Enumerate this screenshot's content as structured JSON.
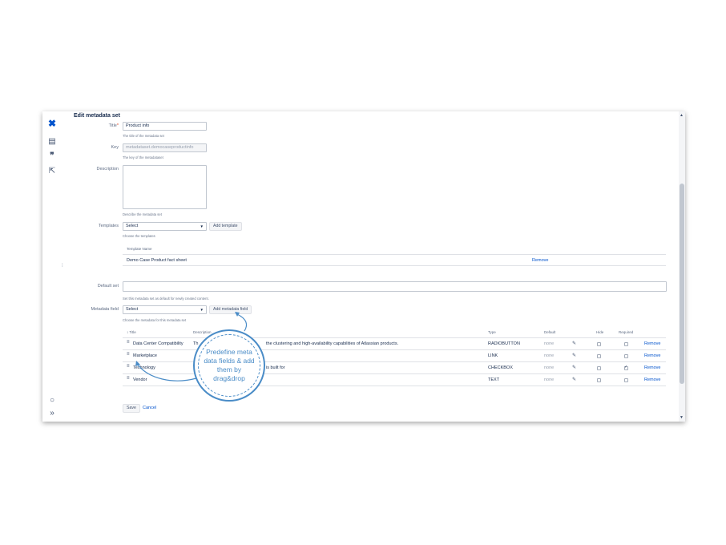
{
  "sidebar": {
    "icons": [
      "confluence-logo-icon",
      "page-icon",
      "quote-icon",
      "export-icon",
      "settings-icon",
      "expand-icon"
    ]
  },
  "form": {
    "heading": "Edit metadata set",
    "title": {
      "label": "Title",
      "required_mark": "*",
      "value": "Product info",
      "help": "The title of the metadata set"
    },
    "key": {
      "label": "Key",
      "value": "metadataset.democaseproductinfo",
      "help": "The key of the metadataset"
    },
    "description": {
      "label": "Description",
      "value": "",
      "help": "Describe the metadata set"
    },
    "templates": {
      "label": "Templates",
      "select_value": "Select",
      "add_button": "Add template",
      "help": "Choose the templates",
      "column_header": "Template Name",
      "rows": [
        {
          "name": "Demo Case Product fact sheet",
          "action": "Remove"
        }
      ]
    },
    "default_set": {
      "label": "Default set",
      "value": "",
      "help": "Set this metadata set as default for newly created content."
    },
    "metadata_field": {
      "label": "Metadata field",
      "select_value": "Select",
      "add_button": "Add metadata field",
      "help": "Choose the metadata for this metadata set",
      "columns": {
        "title": "Title",
        "sort_icon": "↕",
        "description": "Description",
        "type": "Type",
        "default": "Default",
        "hide": "Hide",
        "required": "Required"
      },
      "rows": [
        {
          "title": "Data Center Compatibility",
          "description_start": "Th",
          "description_end": "the clustering and high-availability capabilities of Atlassian products.",
          "type": "RADIOBUTTON",
          "default": "none",
          "hide": false,
          "required": false,
          "action": "Remove"
        },
        {
          "title": "Marketplace",
          "description_start": "",
          "description_end": "",
          "type": "LINK",
          "default": "none",
          "hide": false,
          "required": false,
          "action": "Remove"
        },
        {
          "title": "Technology",
          "description_start": "",
          "description_end": "is built for",
          "type": "CHECKBOX",
          "default": "none",
          "hide": false,
          "required": true,
          "action": "Remove"
        },
        {
          "title": "Vendor",
          "description_start": "",
          "description_end": "",
          "type": "TEXT",
          "default": "none",
          "hide": false,
          "required": false,
          "action": "Remove"
        }
      ]
    },
    "save_button": "Save",
    "cancel_link": "Cancel"
  },
  "callout": {
    "text": "Predefine meta data fields & add them by drag&drop",
    "color": "#4a8cc7"
  },
  "colors": {
    "link": "#0052cc",
    "brand": "#0052cc"
  }
}
